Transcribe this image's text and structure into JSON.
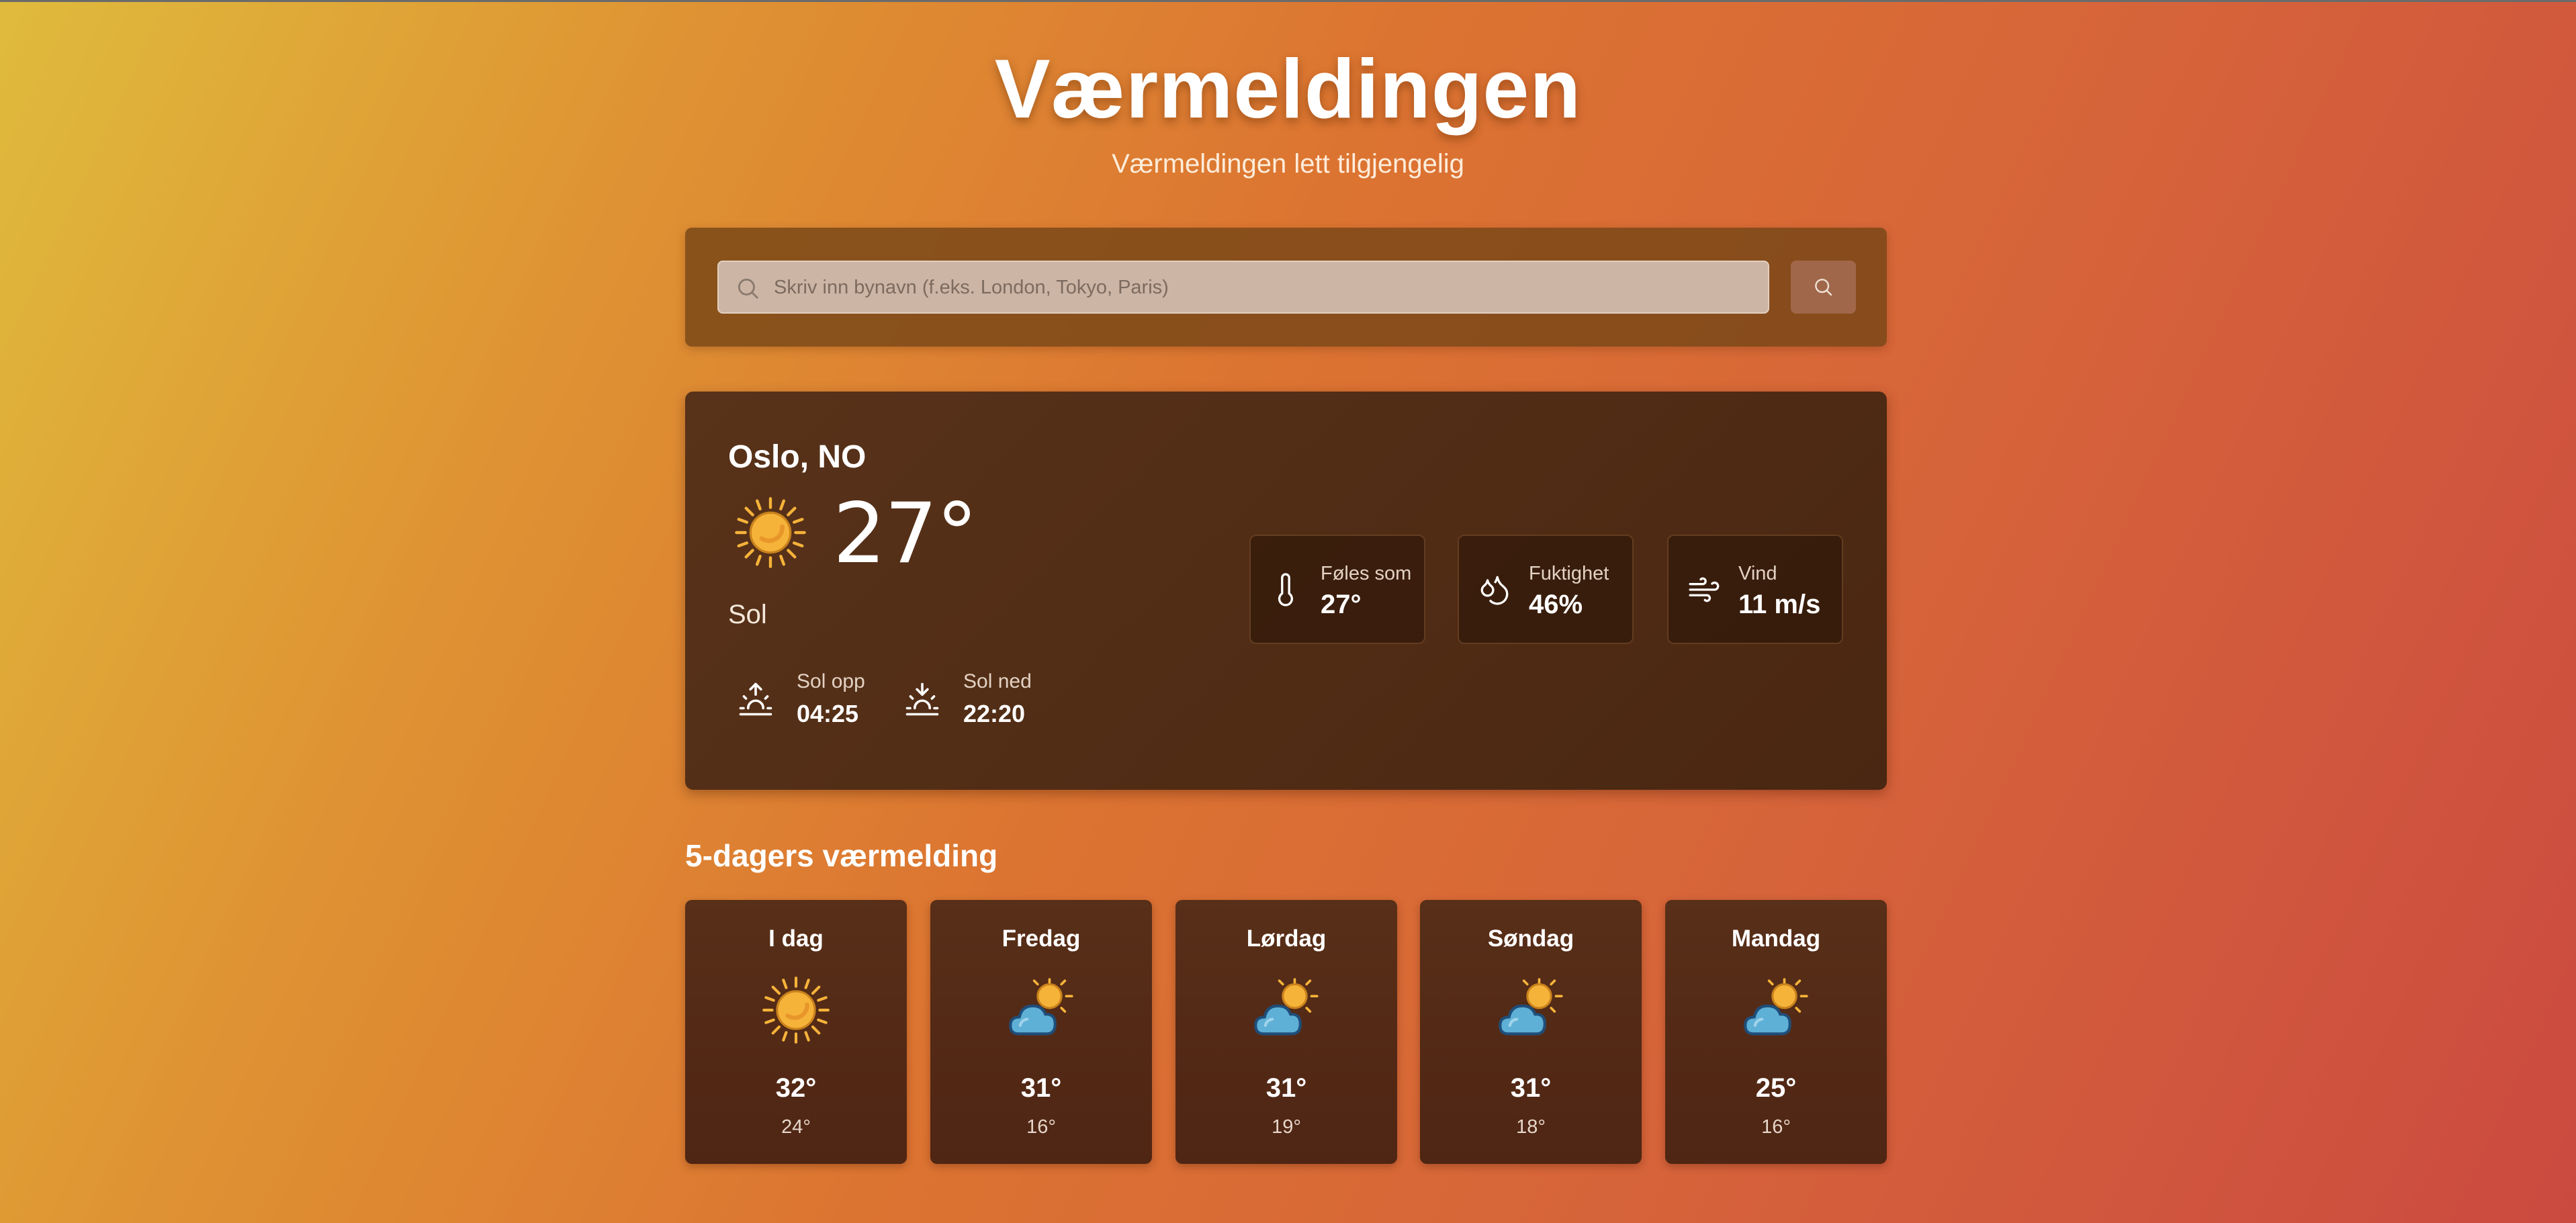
{
  "header": {
    "title": "Værmeldingen",
    "subtitle": "Værmeldingen lett tilgjengelig"
  },
  "search": {
    "placeholder": "Skriv inn bynavn (f.eks. London, Tokyo, Paris)",
    "value": "",
    "button_icon": "search-icon"
  },
  "current": {
    "location": "Oslo, NO",
    "temperature": "27°",
    "condition": "Sol",
    "icon": "sun-icon",
    "sunrise": {
      "label": "Sol opp",
      "value": "04:25",
      "icon": "sunrise-icon"
    },
    "sunset": {
      "label": "Sol ned",
      "value": "22:20",
      "icon": "sunset-icon"
    },
    "stats": [
      {
        "label": "Føles som",
        "value": "27°",
        "icon": "thermometer-icon"
      },
      {
        "label": "Fuktighet",
        "value": "46%",
        "icon": "droplets-icon"
      },
      {
        "label": "Vind",
        "value": "11 m/s",
        "icon": "wind-icon"
      }
    ]
  },
  "forecast": {
    "title": "5-dagers værmelding",
    "days": [
      {
        "name": "I dag",
        "high": "32°",
        "low": "24°",
        "icon": "sun-icon"
      },
      {
        "name": "Fredag",
        "high": "31°",
        "low": "16°",
        "icon": "partly-cloudy-icon"
      },
      {
        "name": "Lørdag",
        "high": "31°",
        "low": "19°",
        "icon": "partly-cloudy-icon"
      },
      {
        "name": "Søndag",
        "high": "31°",
        "low": "18°",
        "icon": "partly-cloudy-icon"
      },
      {
        "name": "Mandag",
        "high": "25°",
        "low": "16°",
        "icon": "partly-cloudy-icon"
      }
    ]
  },
  "colors": {
    "background_start": "#dfbb3c",
    "background_end": "#cb4a40",
    "card": "#4f2a15",
    "sun": "#f6b33a",
    "cloud": "#5fb0d6"
  }
}
